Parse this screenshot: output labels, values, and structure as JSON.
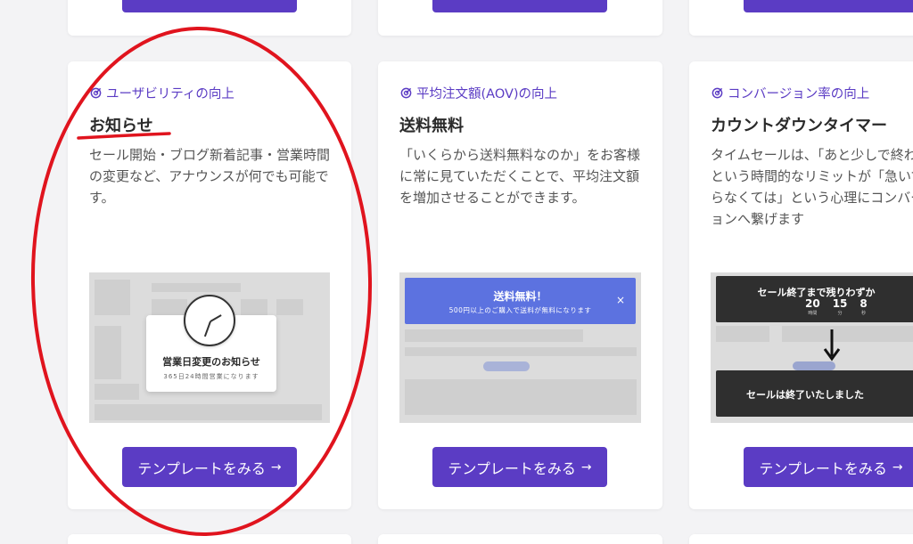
{
  "cards": [
    {
      "category": "ユーザビリティの向上",
      "title": "お知らせ",
      "description": "セール開始・ブログ新着記事・営業時間の変更など、アナウンスが何でも可能です。",
      "preview": {
        "modal_title": "営業日変更のお知らせ",
        "modal_sub": "365日24時間営業になります"
      },
      "button": "テンプレートをみる"
    },
    {
      "category": "平均注文額(AOV)の向上",
      "title": "送料無料",
      "description": "「いくらから送料無料なのか」をお客様に常に見ていただくことで、平均注文額を増加させることができます。",
      "preview": {
        "banner_title": "送料無料！",
        "banner_sub": "500円以上のご購入で送料が無料になります",
        "close": "×"
      },
      "button": "テンプレートをみる"
    },
    {
      "category": "コンバージョン率の向上",
      "title": "カウントダウンタイマー",
      "description": "タイムセールは、「あと少しで終わり」という時間的なリミットが「急いでやらなくては」という心理にコンバージョンへ繋げます",
      "preview": {
        "bar_title": "セール終了まで残りわずか",
        "numbers": [
          {
            "value": "20",
            "unit": "時間"
          },
          {
            "value": "15",
            "unit": "分"
          },
          {
            "value": "8",
            "unit": "秒"
          }
        ],
        "ended": "セールは終了いたしました"
      },
      "button": "テンプレートをみる"
    }
  ],
  "arrow_glyph": "→",
  "colors": {
    "accent": "#5b3cc4",
    "annotation": "#e0141e",
    "banner": "#5c72e0",
    "countdown": "#2f2f2f"
  }
}
